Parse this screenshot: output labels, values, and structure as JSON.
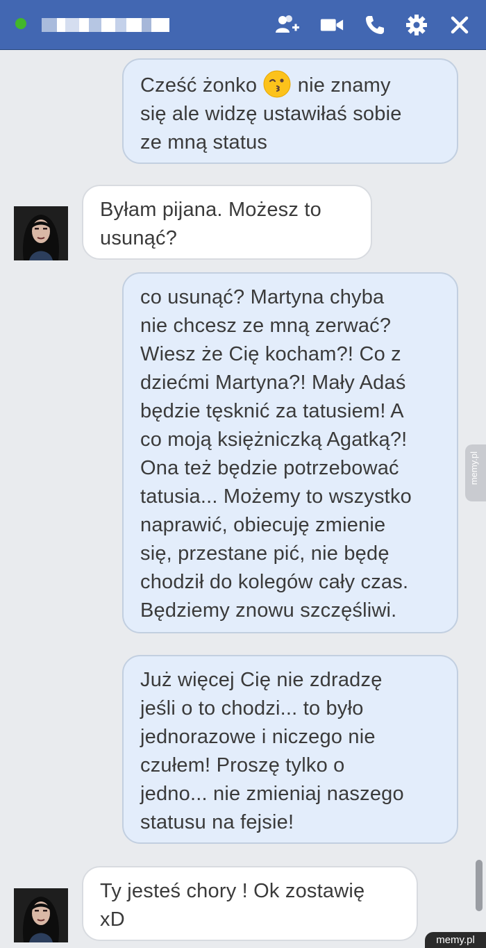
{
  "header": {
    "contact_name_blurred": "",
    "icons": [
      "add-person-icon",
      "video-call-icon",
      "phone-icon",
      "gear-icon",
      "close-icon"
    ],
    "status": "online"
  },
  "messages": [
    {
      "direction": "outgoing",
      "text_before_emoji": "Cześć żonko ",
      "emoji": "kissing-face-emoji",
      "text_after_emoji": " nie znamy\nsię ale widzę ustawiłaś sobie\nze mną status"
    },
    {
      "direction": "incoming",
      "text": "Byłam pijana. Możesz to\nusunąć?"
    },
    {
      "direction": "outgoing",
      "text": "co usunąć? Martyna chyba\nnie chcesz ze mną zerwać?\nWiesz że Cię kocham?! Co z\ndziećmi Martyna?! Mały Adaś\nbędzie tęsknić za tatusiem! A\nco moją księżniczką Agatką?!\nOna też będzie potrzebować\ntatusia... Możemy to wszystko\nnaprawić, obiecuję zmienie\nsię, przestane pić, nie będę\nchodził do kolegów cały czas.\nBędziemy znowu szczęśliwi."
    },
    {
      "direction": "outgoing",
      "text": "Już więcej Cię nie zdradzę\njeśli o to chodzi... to było\njednorazowe i niczego nie\nczułem! Proszę tylko o\njedno... nie zmieniaj naszego\nstatusu na fejsie!"
    },
    {
      "direction": "incoming",
      "text": "Ty jesteś chory ! Ok zostawię\nxD"
    }
  ],
  "side_tab_label": "memy.pl",
  "watermark": "memy.pl",
  "colors": {
    "header_bg": "#4267b2",
    "outgoing_bubble": "#e3edfb",
    "incoming_bubble": "#ffffff",
    "chat_bg": "#e9ebee",
    "presence": "#42b72a"
  }
}
